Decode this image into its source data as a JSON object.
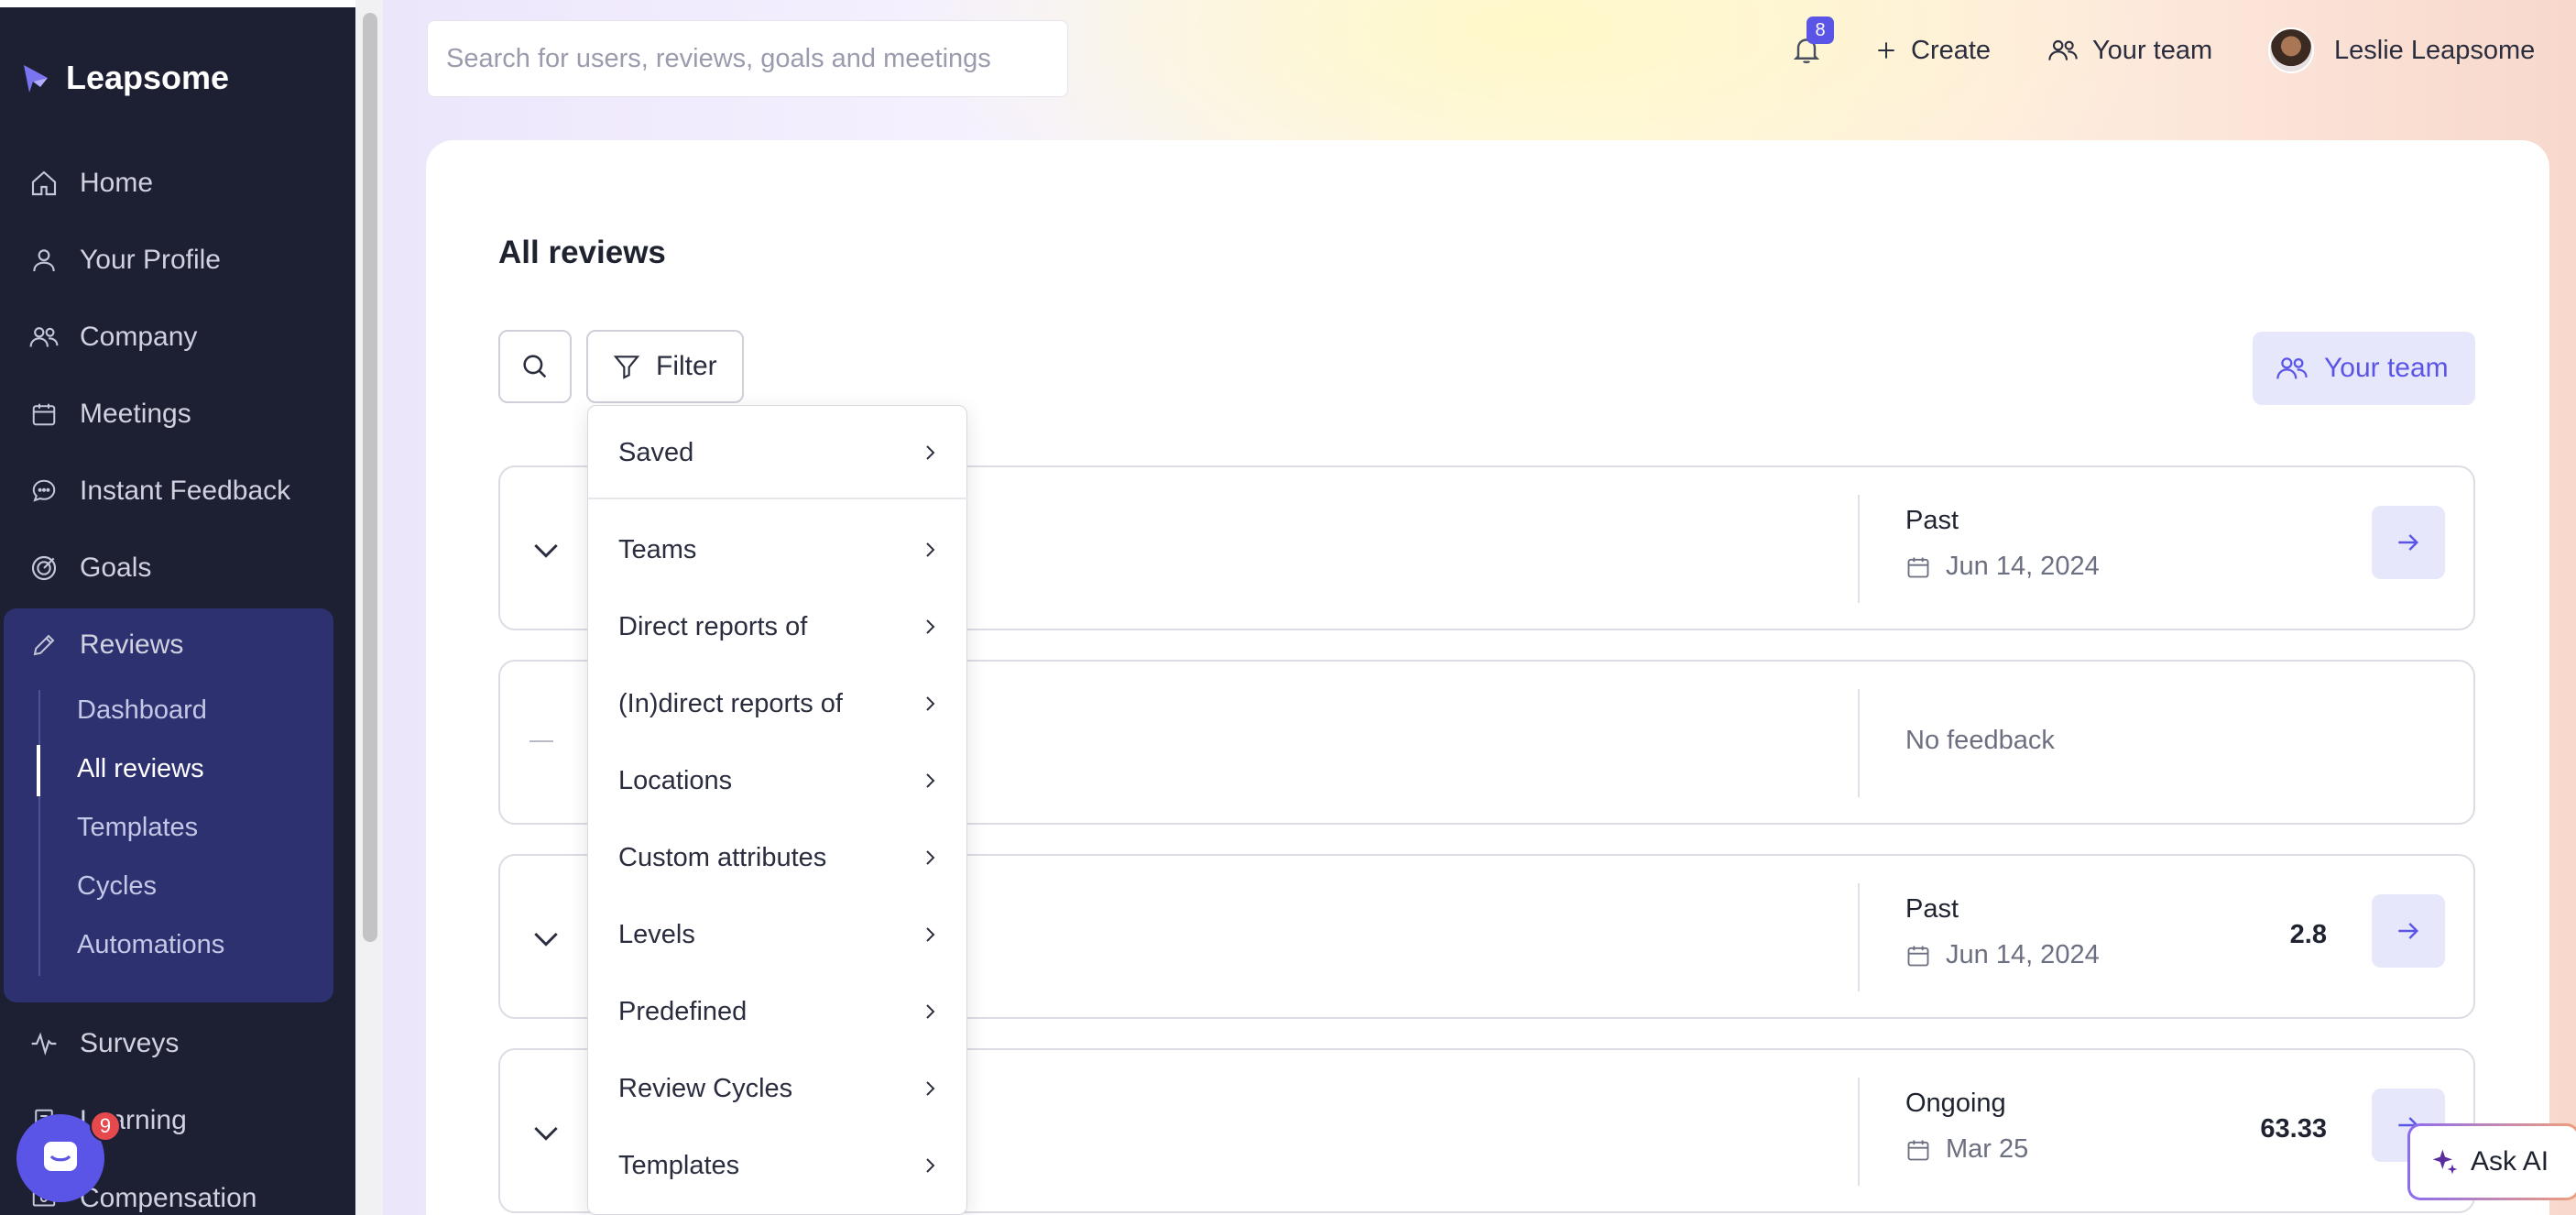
{
  "app": {
    "name": "Leapsome"
  },
  "sidebar": {
    "items": [
      {
        "label": "Home",
        "icon": "home-icon"
      },
      {
        "label": "Your Profile",
        "icon": "user-icon"
      },
      {
        "label": "Company",
        "icon": "users-icon"
      },
      {
        "label": "Meetings",
        "icon": "calendar-icon"
      },
      {
        "label": "Instant Feedback",
        "icon": "chat-icon"
      },
      {
        "label": "Goals",
        "icon": "target-icon"
      },
      {
        "label": "Reviews",
        "icon": "pencil-icon"
      },
      {
        "label": "Surveys",
        "icon": "pulse-icon"
      },
      {
        "label": "Learning",
        "icon": "book-icon"
      },
      {
        "label": "Compensation",
        "icon": "money-icon"
      }
    ],
    "review_sub": [
      "Dashboard",
      "All reviews",
      "Templates",
      "Cycles",
      "Automations"
    ],
    "active_sub": "All reviews"
  },
  "header": {
    "search_placeholder": "Search for users, reviews, goals and meetings",
    "notifications_count": "8",
    "create_label": "Create",
    "your_team_label": "Your team",
    "user_name": "Leslie Leapsome"
  },
  "main": {
    "title": "All reviews",
    "filter_label": "Filter",
    "your_team_label": "Your team",
    "rows": [
      {
        "status": "Past",
        "date": "Jun 14, 2024",
        "score": ""
      },
      {
        "status": "No feedback",
        "date": "",
        "score": ""
      },
      {
        "status": "Past",
        "date": "Jun 14, 2024",
        "score": "2.8"
      },
      {
        "status": "Ongoing",
        "date": "Mar 25",
        "score": "63.33"
      }
    ]
  },
  "filter_menu": {
    "items": [
      "Saved",
      "Teams",
      "Direct reports of",
      "(In)direct reports of",
      "Locations",
      "Custom attributes",
      "Levels",
      "Predefined",
      "Review Cycles",
      "Templates"
    ]
  },
  "chat": {
    "badge": "9"
  },
  "ask_ai": {
    "label": "Ask AI"
  },
  "colors": {
    "sidebar": "#1d1f33",
    "accent": "#5a55e6",
    "active_section": "#2e3170"
  }
}
